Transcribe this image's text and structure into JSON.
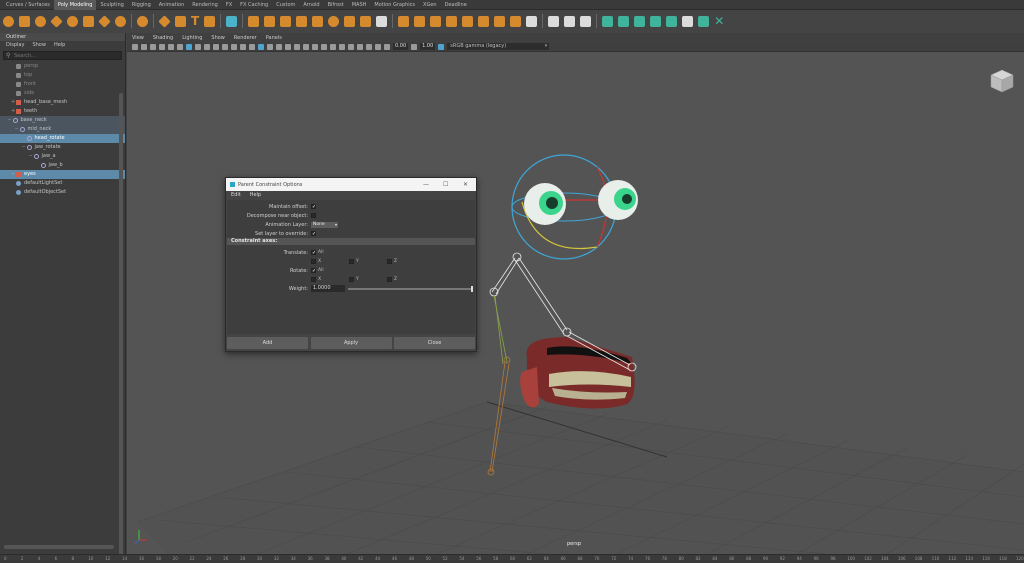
{
  "shelf": {
    "tabs": [
      "Curves / Surfaces",
      "Poly Modeling",
      "Sculpting",
      "Rigging",
      "Animation",
      "Rendering",
      "FX",
      "FX Caching",
      "Custom",
      "Arnold",
      "Bifrost",
      "MASH",
      "Motion Graphics",
      "XGen",
      "Deadline"
    ],
    "active_tab": "Poly Modeling"
  },
  "outliner": {
    "title": "Outliner",
    "menu": [
      "Display",
      "Show",
      "Help"
    ],
    "search_placeholder": "Search...",
    "items": [
      {
        "label": "persp",
        "type": "camera",
        "indent": 2,
        "dim": true
      },
      {
        "label": "top",
        "type": "camera",
        "indent": 2,
        "dim": true
      },
      {
        "label": "front",
        "type": "camera",
        "indent": 2,
        "dim": true
      },
      {
        "label": "side",
        "type": "camera",
        "indent": 2,
        "dim": true
      },
      {
        "label": "head_base_mesh",
        "type": "mesh",
        "indent": 2,
        "exp": "+"
      },
      {
        "label": "teeth",
        "type": "mesh",
        "indent": 2,
        "exp": "+"
      },
      {
        "label": "base_neck",
        "type": "joint",
        "indent": 1,
        "exp": "−",
        "state": "hilite"
      },
      {
        "label": "mid_neck",
        "type": "joint",
        "indent": 3,
        "exp": "−",
        "state": "hilite"
      },
      {
        "label": "head_rotate",
        "type": "joint",
        "indent": 5,
        "state": "selected"
      },
      {
        "label": "jaw_rotate",
        "type": "joint",
        "indent": 5,
        "exp": "−"
      },
      {
        "label": "jaw_a",
        "type": "joint",
        "indent": 7,
        "exp": "−"
      },
      {
        "label": "jaw_b",
        "type": "joint",
        "indent": 9
      },
      {
        "label": "eyes",
        "type": "mesh",
        "indent": 2,
        "exp": "+",
        "state": "selected"
      },
      {
        "label": "defaultLightSet",
        "type": "set",
        "indent": 2
      },
      {
        "label": "defaultObjectSet",
        "type": "set",
        "indent": 2
      }
    ]
  },
  "viewport": {
    "menu": [
      "View",
      "Shading",
      "Lighting",
      "Show",
      "Renderer",
      "Panels"
    ],
    "exposure": "0.00",
    "gamma": "1.00",
    "color_space": "sRGB gamma (legacy)",
    "camera_label": "persp"
  },
  "dialog": {
    "title": "Parent Constraint Options",
    "menu": [
      "Edit",
      "Help"
    ],
    "maintain_offset_label": "Maintain offset:",
    "decompose_label": "Decompose near object:",
    "anim_layer_label": "Animation Layer:",
    "anim_layer_value": "None",
    "set_layer_label": "Set layer to override:",
    "section_label": "Constraint axes:",
    "translate_label": "Translate:",
    "rotate_label": "Rotate:",
    "all_label": "All",
    "x_label": "X",
    "y_label": "Y",
    "z_label": "Z",
    "weight_label": "Weight:",
    "weight_value": "1.0000",
    "weight_fraction": 1.0,
    "buttons": {
      "add": "Add",
      "apply": "Apply",
      "close": "Close"
    }
  },
  "timeline": {
    "ticks": [
      "0",
      "2",
      "4",
      "6",
      "8",
      "10",
      "12",
      "14",
      "16",
      "18",
      "20",
      "22",
      "24",
      "26",
      "28",
      "30",
      "32",
      "34",
      "36",
      "38",
      "40",
      "42",
      "44",
      "46",
      "48",
      "50",
      "52",
      "54",
      "56",
      "58",
      "60",
      "62",
      "64",
      "66",
      "68",
      "70",
      "72",
      "74",
      "76",
      "78",
      "80",
      "82",
      "84",
      "86",
      "88",
      "90",
      "92",
      "94",
      "96",
      "98",
      "100",
      "102",
      "104",
      "106",
      "108",
      "110",
      "112",
      "114",
      "116",
      "118",
      "120"
    ]
  },
  "colors": {
    "accent": "#5d8aa8",
    "shelf_orange": "#d68a2e",
    "shelf_green": "#3fb49a"
  }
}
